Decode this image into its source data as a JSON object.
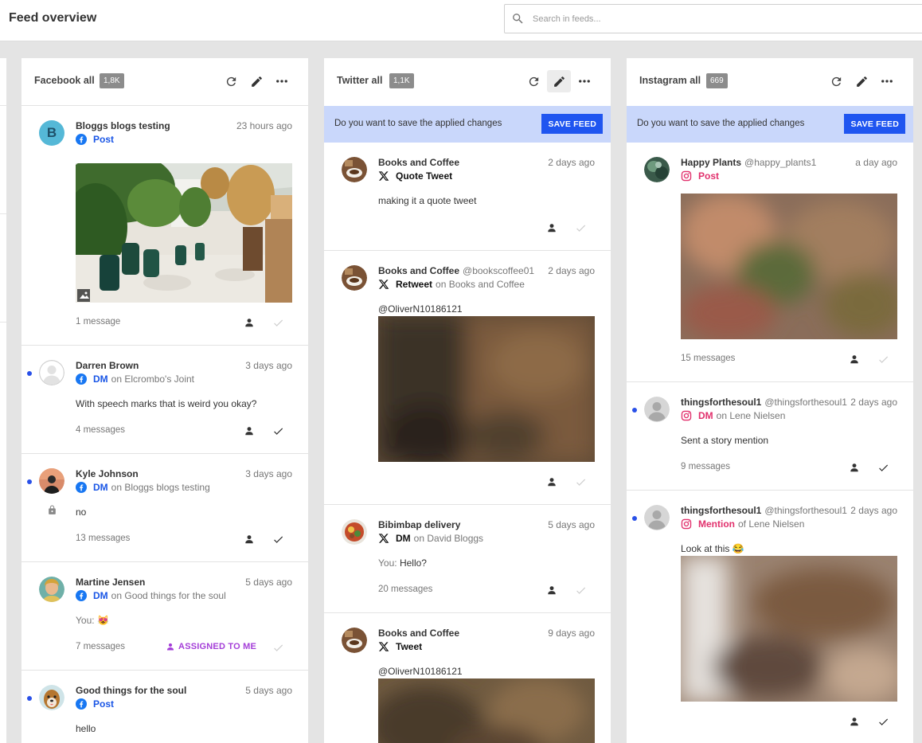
{
  "header": {
    "title": "Feed overview",
    "search_placeholder": "Search in feeds..."
  },
  "banner": {
    "text": "Do you want to save the applied changes",
    "button": "SAVE FEED"
  },
  "columns": {
    "facebook": {
      "title": "Facebook all",
      "count": "1,8K",
      "cards": [
        {
          "name": "Bloggs blogs testing",
          "time": "23 hours ago",
          "type": "Post",
          "count": "1 message",
          "avatar_letter": "B"
        },
        {
          "name": "Darren Brown",
          "time": "3 days ago",
          "type": "DM",
          "on": "on Elcrombo's Joint",
          "message": "With speech marks that is weird you okay?",
          "count": "4 messages"
        },
        {
          "name": "Kyle Johnson",
          "time": "3 days ago",
          "type": "DM",
          "on": "on Bloggs blogs testing",
          "message": "no",
          "count": "13 messages"
        },
        {
          "name": "Martine Jensen",
          "time": "5 days ago",
          "type": "DM",
          "on": "on Good things for the soul",
          "message_prefix": "You:",
          "message": "😻",
          "count": "7 messages",
          "assigned": "ASSIGNED TO ME"
        },
        {
          "name": "Good things for the soul",
          "time": "5 days ago",
          "type": "Post",
          "message": "hello"
        }
      ]
    },
    "twitter": {
      "title": "Twitter all",
      "count": "1,1K",
      "cards": [
        {
          "name": "Books and Coffee",
          "time": "2 days ago",
          "type": "Quote Tweet",
          "message": "making it a quote tweet"
        },
        {
          "name": "Books and Coffee",
          "handle": "@bookscoffee01",
          "time": "2 days ago",
          "type": "Retweet",
          "on": "on Books and Coffee",
          "message": "@OliverN10186121"
        },
        {
          "name": "Bibimbap delivery",
          "time": "5 days ago",
          "type": "DM",
          "on": "on David Bloggs",
          "message_prefix": "You:",
          "message": "Hello?",
          "count": "20 messages"
        },
        {
          "name": "Books and Coffee",
          "time": "9 days ago",
          "type": "Tweet",
          "message": "@OliverN10186121"
        }
      ]
    },
    "instagram": {
      "title": "Instagram all",
      "count": "669",
      "cards": [
        {
          "name": "Happy Plants",
          "handle": "@happy_plants1",
          "time": "a day ago",
          "type": "Post",
          "count": "15 messages"
        },
        {
          "name": "thingsforthesoul1",
          "handle": "@thingsforthesoul1",
          "time": "2 days ago",
          "type": "DM",
          "on": "on Lene Nielsen",
          "message": "Sent a story mention",
          "count": "9 messages"
        },
        {
          "name": "thingsforthesoul1",
          "handle": "@thingsforthesoul1",
          "time": "2 days ago",
          "type": "Mention",
          "on": "of Lene Nielsen",
          "message": "Look at this 😂"
        }
      ]
    }
  },
  "colors": {
    "accent": "#1f55f0",
    "banner_bg": "#c9d7fb",
    "facebook": "#1a56e6",
    "instagram": "#e1306c",
    "assigned": "#a43ed8",
    "unread_dot": "#2950e8"
  },
  "icons": [
    "search-icon",
    "refresh-icon",
    "edit-icon",
    "more-icon",
    "facebook-icon",
    "x-icon",
    "instagram-icon",
    "assign-user-icon",
    "check-icon",
    "lock-icon",
    "image-icon"
  ]
}
